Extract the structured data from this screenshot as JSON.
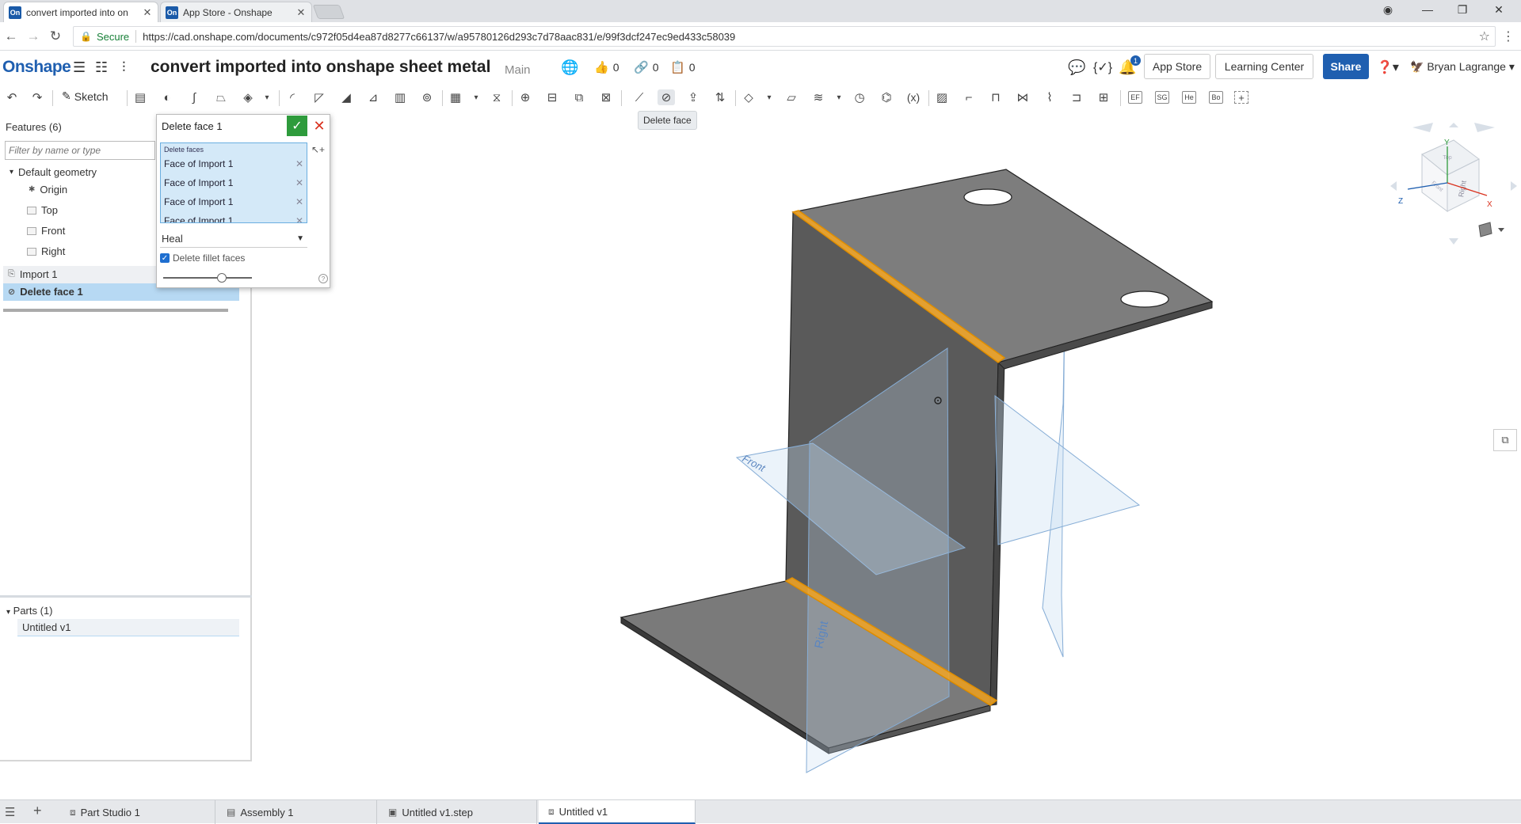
{
  "browser": {
    "tabs": [
      {
        "favicon": "On",
        "title": "convert imported into on"
      },
      {
        "favicon": "On",
        "title": "App Store - Onshape"
      }
    ],
    "secure_label": "Secure",
    "url": "https://cad.onshape.com/documents/c972f05d4ea87d8277c66137/w/a95780126d293c7d78aac831/e/99f3dcf247ec9ed433c58039"
  },
  "header": {
    "logo": "Onshape",
    "document_title": "convert imported into onshape sheet metal",
    "branch": "Main",
    "likes": "0",
    "links": "0",
    "copies": "0",
    "notification_count": "1",
    "app_store_label": "App Store",
    "learning_center_label": "Learning Center",
    "share_label": "Share",
    "user_name": "Bryan Lagrange"
  },
  "toolbar": {
    "sketch_label": "Sketch",
    "box_labels": [
      "EF",
      "SG",
      "He",
      "Bo"
    ],
    "tooltip": "Delete face"
  },
  "features": {
    "title": "Features (6)",
    "filter_placeholder": "Filter by name or type",
    "default_geometry": "Default geometry",
    "origin": "Origin",
    "planes": [
      "Top",
      "Front",
      "Right"
    ],
    "import_label": "Import 1",
    "delete_face_label": "Delete face 1"
  },
  "parts": {
    "title": "Parts (1)",
    "items": [
      "Untitled v1"
    ]
  },
  "dialog": {
    "title": "Delete face 1",
    "selection_label": "Delete faces",
    "selections": [
      "Face of Import 1",
      "Face of Import 1",
      "Face of Import 1",
      "Face of Import 1"
    ],
    "heal_option": "Heal",
    "delete_fillet_label": "Delete fillet faces",
    "delete_fillet_checked": true
  },
  "viewport": {
    "plane_labels": [
      "Front",
      "Right"
    ],
    "viewcube": {
      "face_label": "Right",
      "top_label": "Top",
      "front_label": "Front",
      "axis_x": "X",
      "axis_y": "Y",
      "axis_z": "Z"
    },
    "colors": {
      "part": "#6e6e6e",
      "part_dark": "#4f4f4f",
      "highlight": "#f5a623",
      "plane": "#b8d4ee"
    }
  },
  "bottom_tabs": [
    {
      "label": "Part Studio 1",
      "icon": "part-studio-icon"
    },
    {
      "label": "Assembly 1",
      "icon": "assembly-icon"
    },
    {
      "label": "Untitled v1.step",
      "icon": "step-file-icon"
    },
    {
      "label": "Untitled v1",
      "icon": "part-studio-icon"
    }
  ]
}
